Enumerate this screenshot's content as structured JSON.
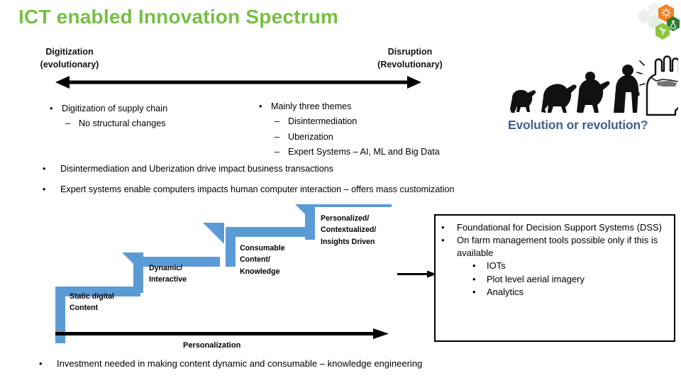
{
  "title": "ICT enabled Innovation Spectrum",
  "colors": {
    "title_green": "#76c043",
    "step_blue": "#5b9bd5",
    "caption_blue": "#41628f",
    "logo_orange": "#f58220",
    "logo_dark_green": "#2e7d32",
    "logo_light_green": "#8dc63f"
  },
  "spectrum": {
    "left_label_line1": "Digitization",
    "left_label_line2": "(evolutionary)",
    "right_label_line1": "Disruption",
    "right_label_line2": "(Revolutionary)"
  },
  "left_bullets": [
    {
      "level": 1,
      "marker": "•",
      "text": "Digitization of supply chain"
    },
    {
      "level": 2,
      "marker": "–",
      "text": "No structural changes"
    }
  ],
  "right_bullets": [
    {
      "level": 1,
      "marker": "•",
      "text": "Mainly three themes"
    },
    {
      "level": 2,
      "marker": "–",
      "text": "Disintermediation"
    },
    {
      "level": 2,
      "marker": "–",
      "text": "Uberization"
    },
    {
      "level": 2,
      "marker": "–",
      "text": "Expert Systems – AI, ML and Big Data"
    }
  ],
  "wide_bullets": [
    {
      "marker": "•",
      "text": "Disintermediation and Uberization drive impact business transactions"
    },
    {
      "marker": "•",
      "text": "Expert systems enable computers impacts human computer interaction – offers mass customization"
    }
  ],
  "evolution": {
    "caption": "Evolution or revolution?",
    "icon": "evolution-to-fist-illustration"
  },
  "staircase": {
    "steps": [
      {
        "label": "Static digital\nContent",
        "line1": "Static digital",
        "line2": "Content"
      },
      {
        "label": "Dynamic/\nInteractive",
        "line1": "Dynamic/",
        "line2": "Interactive"
      },
      {
        "label": "Consumable Content/ Knowledge",
        "line1": "Consumable",
        "line2": "Content/",
        "line3": "Knowledge"
      },
      {
        "label": "Personalized/ Contextualized/ Insights Driven",
        "line1": "Personalized/",
        "line2": "Contextualized/",
        "line3": "Insights Driven"
      }
    ],
    "axis_label": "Personalization"
  },
  "info_box": {
    "bullets": [
      {
        "level": 1,
        "marker": "•",
        "text": "Foundational for Decision Support Systems (DSS)"
      },
      {
        "level": 1,
        "marker": "•",
        "text": "On farm management tools possible only if this is available"
      },
      {
        "level": 2,
        "marker": "•",
        "text": "IOTs"
      },
      {
        "level": 2,
        "marker": "•",
        "text": "Plot level aerial imagery"
      },
      {
        "level": 2,
        "marker": "•",
        "text": "Analytics"
      }
    ]
  },
  "final_bullet": {
    "marker": "•",
    "text": "Investment needed in making content dynamic and consumable – knowledge engineering"
  }
}
